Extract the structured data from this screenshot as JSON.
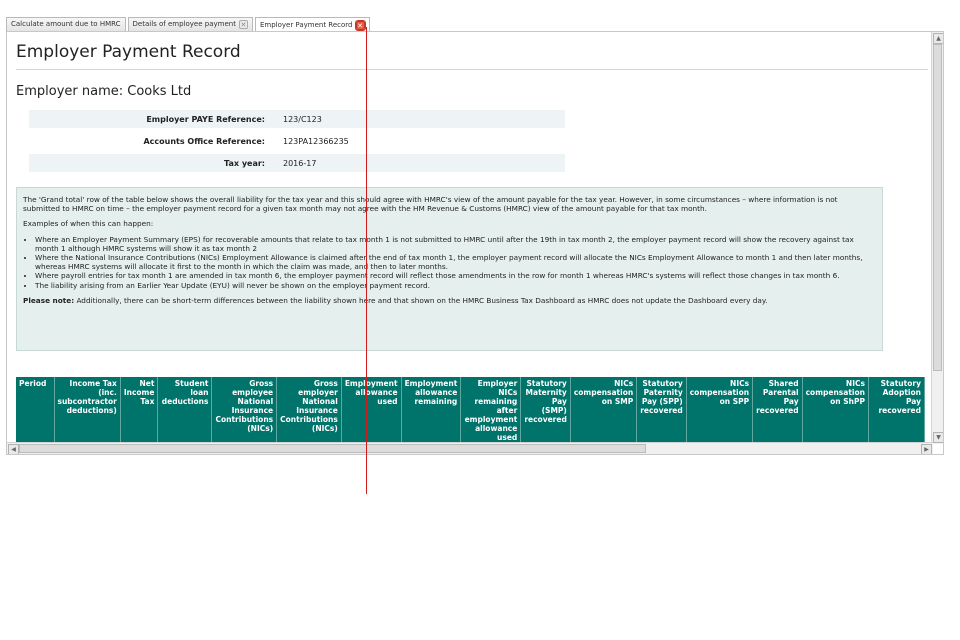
{
  "tabs": [
    {
      "label": "Calculate amount due to HMRC",
      "closable": false
    },
    {
      "label": "Details of employee payment",
      "closable": true
    },
    {
      "label": "Employer Payment Record",
      "closable": true,
      "active": true
    }
  ],
  "page": {
    "title": "Employer Payment Record",
    "employer_name": "Employer name: Cooks Ltd"
  },
  "info": [
    {
      "label": "Employer PAYE Reference:",
      "value": "123/C123"
    },
    {
      "label": "Accounts Office Reference:",
      "value": "123PA12366235"
    },
    {
      "label": "Tax year:",
      "value": "2016-17"
    }
  ],
  "notice": {
    "intro": "The 'Grand total' row of the table below shows the overall liability for the tax year and this should agree with HMRC's view of the amount payable for the tax year. However, in some circumstances – where information is not submitted to HMRC on time – the employer payment record for a given tax month may not agree with the HM Revenue & Customs (HMRC) view of the amount payable for that tax month.",
    "examples_heading": "Examples of when this can happen:",
    "examples": [
      "Where an Employer Payment Summary (EPS) for recoverable amounts that relate to tax month 1 is not submitted to HMRC until after the 19th in tax month 2, the employer payment record will show the recovery against tax month 1 although HMRC systems will show it as tax month 2",
      "Where the National Insurance Contributions (NICs) Employment Allowance is claimed after the end of tax month 1, the employer payment record will allocate the NICs Employment Allowance to month 1 and then later months, whereas HMRC systems will allocate it first to the month in which the claim was made, and then to later months.",
      "Where payroll entries for tax month 1 are amended in tax month 6, the employer payment record will reflect those amendments in the row for month 1 whereas HMRC's systems will reflect those changes in tax month 6.",
      "The liability arising from an Earlier Year Update (EYU) will never be shown on the employer payment record."
    ],
    "note_label": "Please note:",
    "note_text": " Additionally, there can be short-term differences between the liability shown here and that shown on the HMRC Business Tax Dashboard as HMRC does not update the Dashboard every day."
  },
  "table": {
    "headers": [
      "Period",
      "Income Tax (inc. subcontractor deductions)",
      "Net Income Tax",
      "Student loan deductions",
      "Gross employee National Insurance Contributions (NICs)",
      "Gross employer National Insurance Contributions (NICs)",
      "Employment allowance used",
      "Employment allowance remaining",
      "Employer NICs remaining after employment allowance used",
      "Statutory Maternity Pay (SMP) recovered",
      "NICs compensation on SMP",
      "Statutory Paternity Pay (SPP) recovered",
      "NICs compensation on SPP",
      "Shared Parental Pay recovered",
      "NICs compensation on ShPP",
      "Statutory Adoption Pay recovered"
    ]
  },
  "scrollbar_glyphs": {
    "up": "▲",
    "down": "▼",
    "left": "◀",
    "right": "▶"
  },
  "close_glyph": "✕",
  "colors": {
    "table_header": "#00736a",
    "notice_bg": "#e5efee",
    "pointer": "#d11b1b",
    "close_hot": "#e85a3a"
  }
}
